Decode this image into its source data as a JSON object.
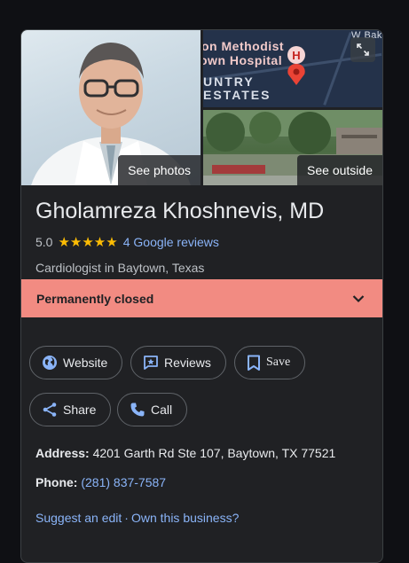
{
  "photos": {
    "see_photos_label": "See photos",
    "see_outside_label": "See outside",
    "map_labels": [
      "on Methodist",
      "own Hospital",
      "UNTRY",
      "ESTATES"
    ],
    "map_corner_text": "W Bak",
    "pin_letter": "H"
  },
  "business": {
    "name": "Gholamreza Khoshnevis, MD",
    "rating": "5.0",
    "stars": "★★★★★",
    "reviews_link": "4 Google reviews",
    "category": "Cardiologist in Baytown, Texas"
  },
  "status": {
    "closed_label": "Permanently closed"
  },
  "actions": {
    "website": "Website",
    "reviews": "Reviews",
    "save": "Save",
    "share": "Share",
    "call": "Call"
  },
  "info": {
    "address_label": "Address:",
    "address_value": "4201 Garth Rd Ste 107, Baytown, TX 77521",
    "phone_label": "Phone:",
    "phone_value": "(281) 837-7587"
  },
  "footer": {
    "suggest_edit": "Suggest an edit",
    "separator": "·",
    "own_business": "Own this business?"
  },
  "colors": {
    "background": "#0f1014",
    "card": "#202124",
    "closed_banner": "#f28b82",
    "link": "#8ab4f8",
    "star": "#fbbc04",
    "map_pin": "#ea4335"
  },
  "icons": [
    "globe-icon",
    "review-star-icon",
    "bookmark-icon",
    "share-icon",
    "phone-icon",
    "chevron-down-icon",
    "expand-icon",
    "map-pin-icon"
  ]
}
